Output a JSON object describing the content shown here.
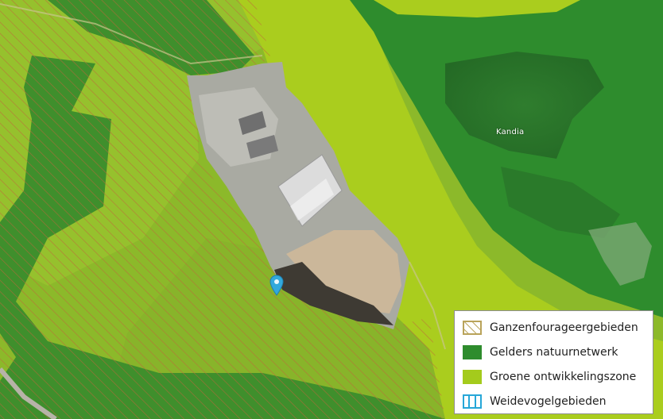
{
  "map": {
    "place_label": "Kandia",
    "marker_icon": "map-pin-icon",
    "marker_color": "#33a9dc"
  },
  "legend": {
    "items": [
      {
        "label": "Ganzenfourageergebieden",
        "swatch": "hatch",
        "color": "#b9a35a"
      },
      {
        "label": "Gelders natuurnetwerk",
        "swatch": "fill",
        "color": "#2e8c2d"
      },
      {
        "label": "Groene ontwikkelingszone",
        "swatch": "fill",
        "color": "#a4cb1c"
      },
      {
        "label": "Weidevogelgebieden",
        "swatch": "vbars",
        "color": "#27a7d8"
      }
    ]
  }
}
